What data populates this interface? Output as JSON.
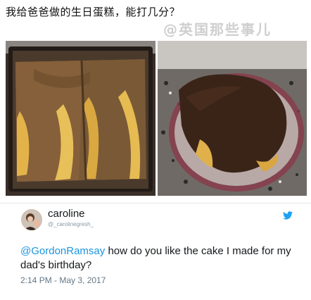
{
  "caption": "我给爸爸做的生日蛋糕，能打几分？",
  "watermark": "@英国那些事儿",
  "tweet": {
    "name": "caroline",
    "handle": "@_carolinegresh_",
    "mention": "@GordonRamsay",
    "text": " how do you like the cake I made for my dad's birthday?",
    "timestamp": "2:14 PM - May 3, 2017"
  },
  "colors": {
    "link": "#1b95e0",
    "twitter_blue": "#1da1f2"
  },
  "icons": [
    "twitter-bird-icon"
  ]
}
